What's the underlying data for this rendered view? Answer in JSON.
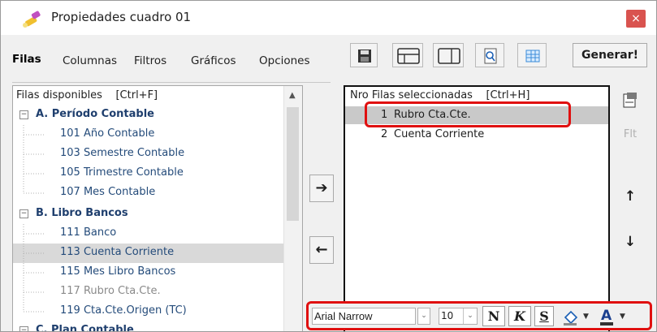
{
  "window": {
    "title": "Propiedades cuadro 01",
    "close_glyph": "×"
  },
  "tabs": [
    {
      "label": "Filas",
      "active": true
    },
    {
      "label": "Columnas",
      "active": false
    },
    {
      "label": "Filtros",
      "active": false
    },
    {
      "label": "Gráficos",
      "active": false
    },
    {
      "label": "Opciones",
      "active": false
    }
  ],
  "toolbar": {
    "icons": [
      "save-icon",
      "layout-rows-icon",
      "layout-columns-icon",
      "preview-icon",
      "grid-icon"
    ],
    "generate_label": "Generar!"
  },
  "available": {
    "header": "Filas disponibles    [Ctrl+F]",
    "groups": [
      {
        "label": "A. Período Contable",
        "items": [
          "101 Año Contable",
          "103 Semestre Contable",
          "105 Trimestre Contable",
          "107 Mes Contable"
        ]
      },
      {
        "label": "B. Libro Bancos",
        "items": [
          "111 Banco",
          "113 Cuenta Corriente",
          "115 Mes Libro Bancos",
          "117 Rubro Cta.Cte.",
          "119 Cta.Cte.Origen (TC)"
        ]
      },
      {
        "label": "C. Plan Contable",
        "items": []
      }
    ],
    "selected_item": "113 Cuenta Corriente",
    "dim_item": "117 Rubro Cta.Cte."
  },
  "selected": {
    "header": "Nro Filas seleccionadas    [Ctrl+H]",
    "rows": [
      {
        "nro": "1",
        "name": "Rubro Cta.Cte."
      },
      {
        "nro": "2",
        "name": "Cuenta Corriente"
      }
    ]
  },
  "buttons": {
    "add": "➔",
    "remove": "←",
    "up": "↑",
    "down": "↓",
    "ft": "Flt"
  },
  "format": {
    "font_name": "Arial Narrow",
    "font_size": "10",
    "bold": "N",
    "italic": "K",
    "strike": "S",
    "highlight_label": "A",
    "accent": "#e01010"
  }
}
